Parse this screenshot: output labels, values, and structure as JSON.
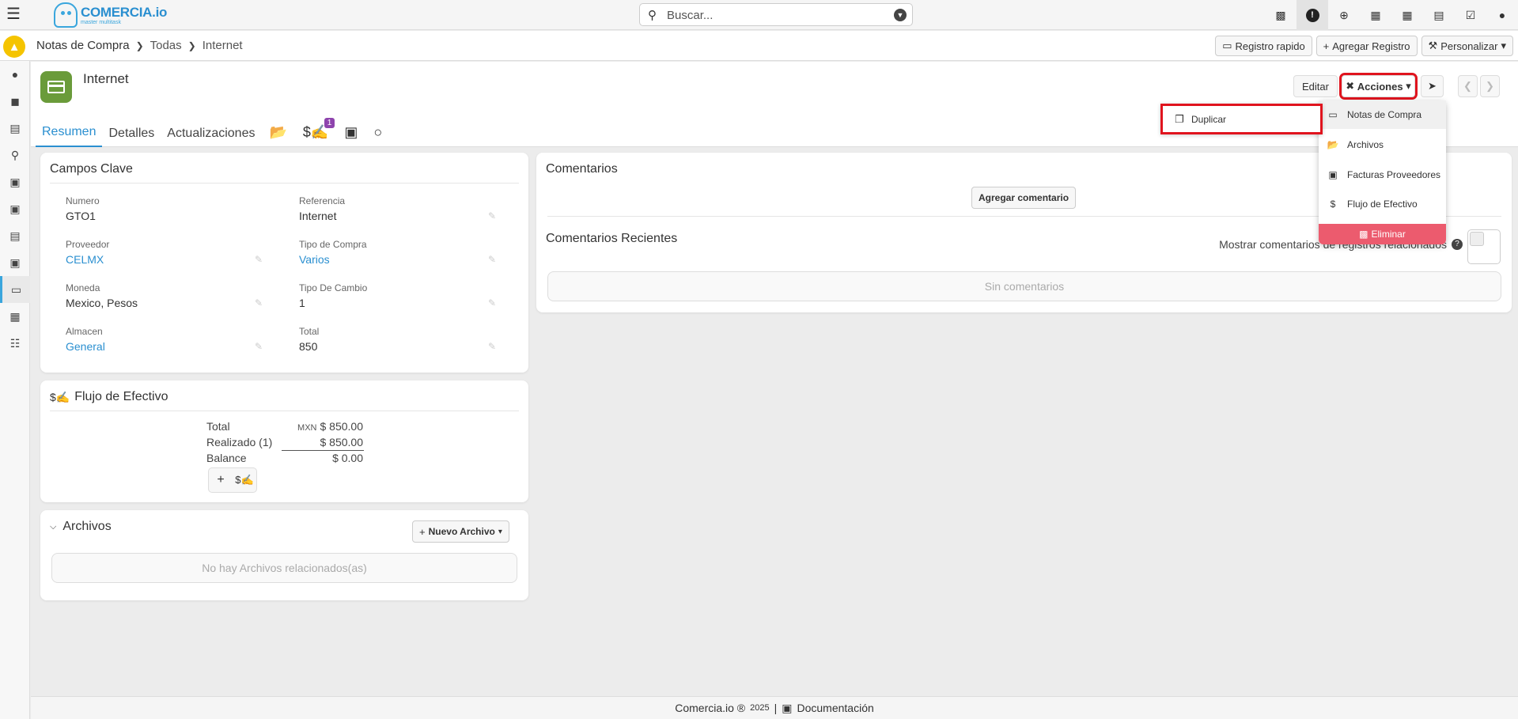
{
  "app": {
    "logo_name": "COMERCIA.io",
    "logo_tagline": "master multitask",
    "search_placeholder": "Buscar..."
  },
  "breadcrumb": {
    "items": [
      "Notas de Compra",
      "Todas",
      "Internet"
    ]
  },
  "crumb_actions": {
    "quick": "Registro rapido",
    "add": "Agregar Registro",
    "customize": "Personalizar"
  },
  "record": {
    "title": "Internet",
    "tabs": [
      "Resumen",
      "Detalles",
      "Actualizaciones"
    ],
    "cashflow_badge": "1",
    "edit_label": "Editar",
    "actions_label": "Acciones"
  },
  "actions_menu": {
    "submenu_item": "Duplicar",
    "items": [
      "Notas de Compra",
      "Archivos",
      "Facturas Proveedores",
      "Flujo de Efectivo"
    ],
    "delete": "Eliminar"
  },
  "key_fields": {
    "title": "Campos Clave",
    "fields": [
      {
        "label": "Numero",
        "value": "GTO1"
      },
      {
        "label": "Referencia",
        "value": "Internet"
      },
      {
        "label": "Proveedor",
        "value": "CELMX"
      },
      {
        "label": "Tipo de Compra",
        "value": "Varios"
      },
      {
        "label": "Moneda",
        "value": "Mexico, Pesos"
      },
      {
        "label": "Tipo De Cambio",
        "value": "1"
      },
      {
        "label": "Almacen",
        "value": "General"
      },
      {
        "label": "Total",
        "value": "850"
      }
    ]
  },
  "cashflow": {
    "title": "Flujo de Efectivo",
    "rows": [
      {
        "label": "Total",
        "currency": "MXN",
        "amount": "$ 850.00"
      },
      {
        "label": "Realizado (1)",
        "amount": "$ 850.00"
      },
      {
        "label": "Balance",
        "amount": "$ 0.00"
      }
    ]
  },
  "files": {
    "title": "Archivos",
    "new_label": "Nuevo Archivo",
    "empty": "No hay Archivos relacionados(as)"
  },
  "comments": {
    "title": "Comentarios",
    "add_label": "Agregar comentario",
    "recent_title": "Comentarios Recientes",
    "show_related": "Mostrar comentarios de registros relacionados",
    "empty": "Sin comentarios"
  },
  "footer": {
    "brand": "Comercia.io ®",
    "year": "2025",
    "docs": "Documentación"
  },
  "colors": {
    "accent": "#2a8fd0",
    "highlight": "#e0141e",
    "delete": "#ec5b6e",
    "record_icon": "#6a9b3a",
    "home_badge": "#f5c400"
  }
}
